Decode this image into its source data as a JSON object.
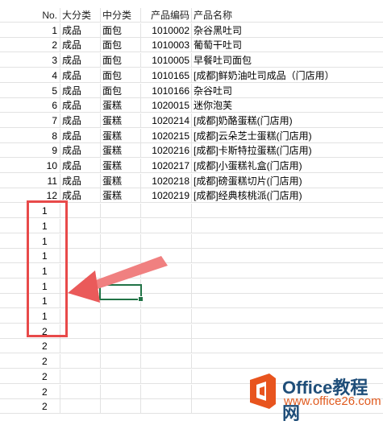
{
  "headers": [
    "No.",
    "大分类",
    "中分类",
    "产品编码",
    "产品名称"
  ],
  "rows": [
    {
      "no": "1",
      "cat": "成品",
      "sub": "面包",
      "code": "1010002",
      "name": "杂谷黑吐司"
    },
    {
      "no": "2",
      "cat": "成品",
      "sub": "面包",
      "code": "1010003",
      "name": "葡萄干吐司"
    },
    {
      "no": "3",
      "cat": "成品",
      "sub": "面包",
      "code": "1010005",
      "name": "早餐吐司面包"
    },
    {
      "no": "4",
      "cat": "成品",
      "sub": "面包",
      "code": "1010165",
      "name": "[成都]鲜奶油吐司成品（门店用）"
    },
    {
      "no": "5",
      "cat": "成品",
      "sub": "面包",
      "code": "1010166",
      "name": "杂谷吐司"
    },
    {
      "no": "6",
      "cat": "成品",
      "sub": "蛋糕",
      "code": "1020015",
      "name": "迷你泡芙"
    },
    {
      "no": "7",
      "cat": "成品",
      "sub": "蛋糕",
      "code": "1020214",
      "name": "[成都]奶酪蛋糕(门店用)"
    },
    {
      "no": "8",
      "cat": "成品",
      "sub": "蛋糕",
      "code": "1020215",
      "name": "[成都]云朵芝士蛋糕(门店用)"
    },
    {
      "no": "9",
      "cat": "成品",
      "sub": "蛋糕",
      "code": "1020216",
      "name": "[成都]卡斯特拉蛋糕(门店用)"
    },
    {
      "no": "10",
      "cat": "成品",
      "sub": "蛋糕",
      "code": "1020217",
      "name": "[成都]小蛋糕礼盒(门店用)"
    },
    {
      "no": "11",
      "cat": "成品",
      "sub": "蛋糕",
      "code": "1020218",
      "name": "[成都]磅蛋糕切片(门店用)"
    },
    {
      "no": "12",
      "cat": "成品",
      "sub": "蛋糕",
      "code": "1020219",
      "name": "[成都]经典核桃派(门店用)"
    }
  ],
  "col_a_values": [
    "1",
    "1",
    "1",
    "1",
    "1",
    "1",
    "1",
    "1",
    "2",
    "2",
    "2",
    "2",
    "2",
    "2"
  ],
  "logo": {
    "title": "Office教程网",
    "url": "www.office26.com"
  },
  "colors": {
    "selection": "#217346",
    "annotation": "#e84a4a",
    "logo_blue": "#1f4e79",
    "logo_orange": "#e05a1e"
  }
}
